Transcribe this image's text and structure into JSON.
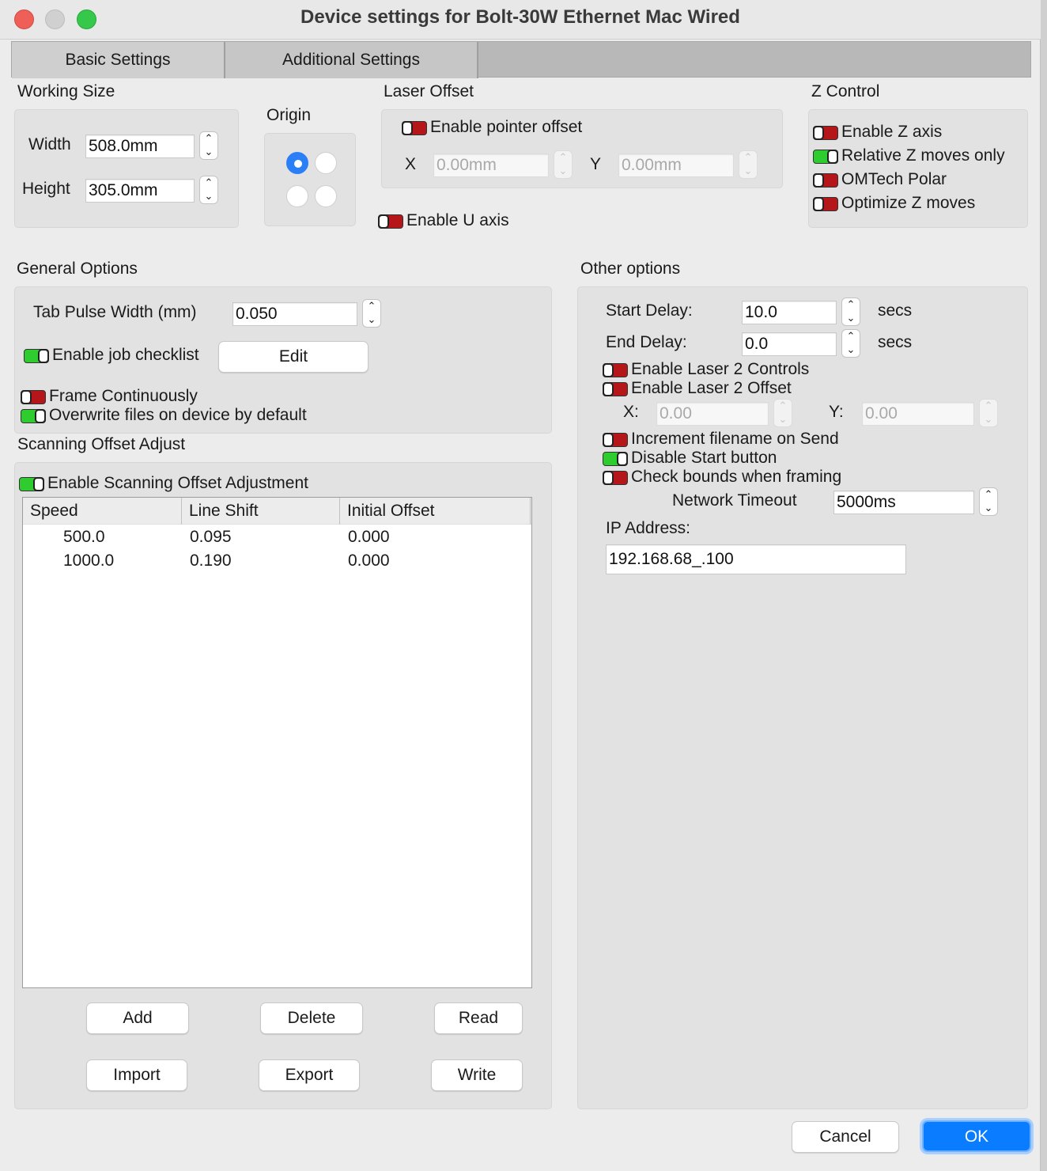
{
  "window": {
    "title": "Device settings for Bolt-30W Ethernet Mac Wired"
  },
  "tabs": [
    {
      "label": "Basic Settings",
      "active": true
    },
    {
      "label": "Additional Settings",
      "active": false
    }
  ],
  "working_size": {
    "title": "Working Size",
    "width_label": "Width",
    "width_value": "508.0mm",
    "height_label": "Height",
    "height_value": "305.0mm"
  },
  "origin": {
    "title": "Origin",
    "selected": "top-left"
  },
  "laser_offset": {
    "title": "Laser Offset",
    "enable_pointer_label": "Enable pointer offset",
    "enable_pointer_on": false,
    "x_label": "X",
    "x_value": "0.00mm",
    "y_label": "Y",
    "y_value": "0.00mm",
    "enable_u_label": "Enable U axis",
    "enable_u_on": false
  },
  "z_control": {
    "title": "Z Control",
    "items": [
      {
        "label": "Enable Z axis",
        "on": false
      },
      {
        "label": "Relative Z moves only",
        "on": true
      },
      {
        "label": "OMTech Polar",
        "on": false
      },
      {
        "label": "Optimize Z moves",
        "on": false
      }
    ]
  },
  "general": {
    "title": "General Options",
    "tab_pulse_label": "Tab Pulse Width (mm)",
    "tab_pulse_value": "0.050",
    "job_checklist_label": "Enable job checklist",
    "job_checklist_on": true,
    "edit_label": "Edit",
    "frame_cont_label": "Frame Continuously",
    "frame_cont_on": false,
    "overwrite_label": "Overwrite files on device by default",
    "overwrite_on": true
  },
  "scanning": {
    "title": "Scanning Offset Adjust",
    "enable_label": "Enable Scanning Offset Adjustment",
    "enable_on": true,
    "columns": [
      "Speed",
      "Line Shift",
      "Initial Offset"
    ],
    "rows": [
      [
        "500.0",
        "0.095",
        "0.000"
      ],
      [
        "1000.0",
        "0.190",
        "0.000"
      ]
    ],
    "buttons": {
      "add": "Add",
      "delete": "Delete",
      "read": "Read",
      "import": "Import",
      "export": "Export",
      "write": "Write"
    }
  },
  "other": {
    "title": "Other options",
    "start_delay_label": "Start Delay:",
    "start_delay_value": "10.0",
    "end_delay_label": "End Delay:",
    "end_delay_value": "0.0",
    "secs": "secs",
    "laser2_controls_label": "Enable Laser 2 Controls",
    "laser2_controls_on": false,
    "laser2_offset_label": "Enable Laser 2 Offset",
    "laser2_offset_on": false,
    "x_label": "X:",
    "x_value": "0.00",
    "y_label": "Y:",
    "y_value": "0.00",
    "increment_label": "Increment filename on Send",
    "increment_on": false,
    "disable_start_label": "Disable Start button",
    "disable_start_on": true,
    "check_bounds_label": "Check bounds when framing",
    "check_bounds_on": false,
    "network_timeout_label": "Network Timeout",
    "network_timeout_value": "5000ms",
    "ip_label": "IP Address:",
    "ip_value": "192.168.68_.100"
  },
  "footer": {
    "cancel": "Cancel",
    "ok": "OK"
  }
}
